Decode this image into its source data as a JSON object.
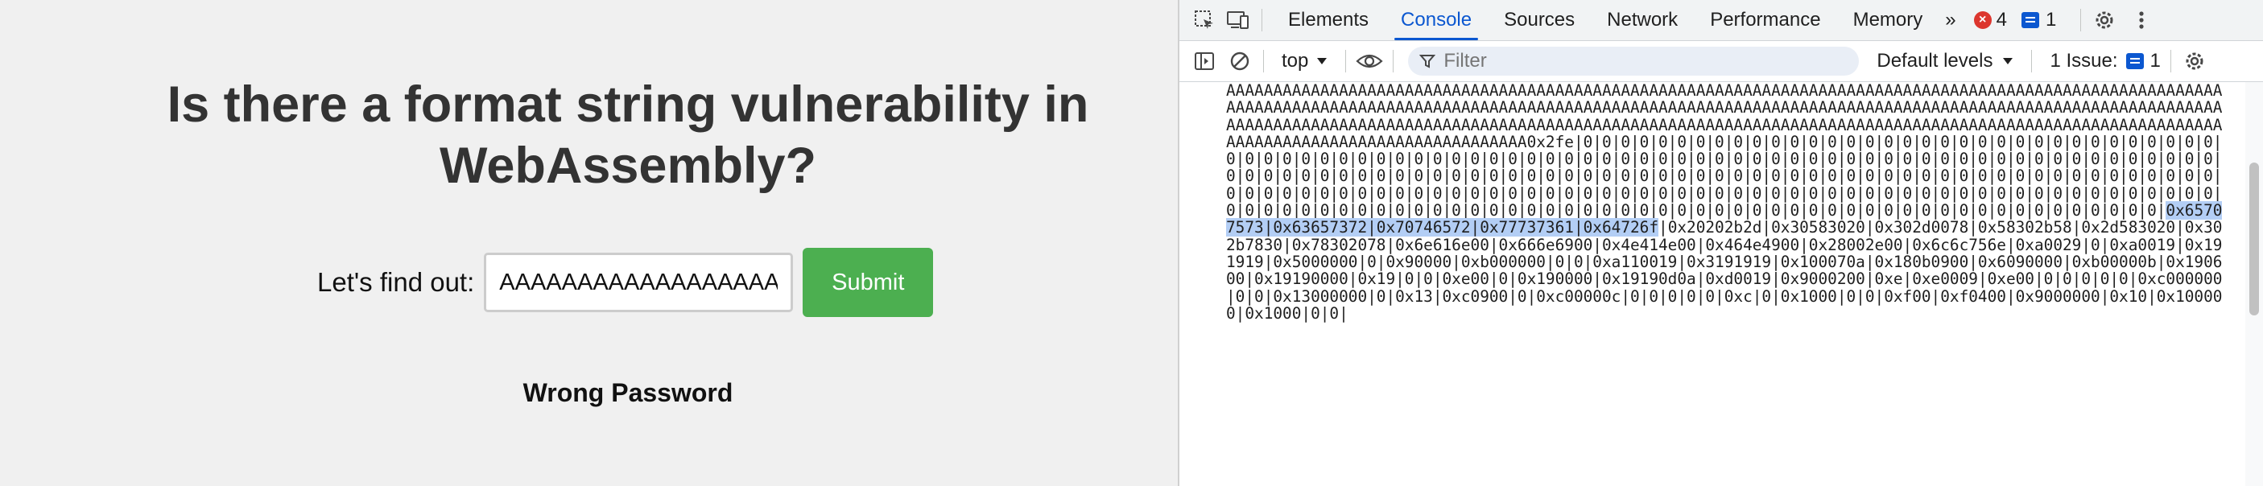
{
  "page": {
    "title": "Is there a format string vulnerability in WebAssembly?",
    "form_label": "Let's find out:",
    "input_value": "AAAAAAAAAAAAAAAAAAAAAAAAAAAAAAAAAAAA",
    "submit_label": "Submit",
    "result": "Wrong Password"
  },
  "devtools": {
    "tabs": [
      "Elements",
      "Console",
      "Sources",
      "Network",
      "Performance",
      "Memory"
    ],
    "active_tab": "Console",
    "more_tabs_glyph": "»",
    "error_count": "4",
    "message_count": "1",
    "context": "top",
    "filter_placeholder": "Filter",
    "levels": "Default levels",
    "issues_label": "1 Issue:",
    "issues_count": "1",
    "console": {
      "before_highlight": "AAAAAAAAAAAAAAAAAAAAAAAAAAAAAAAAAAAAAAAAAAAAAAAAAAAAAAAAAAAAAAAAAAAAAAAAAAAAAAAAAAAAAAAAAAAAAAAAAAAAAAAAAAAAAAAAAAAAAAAAAAAAAAAAAAAAAAAAAAAAAAAAAAAAAAAAAAAAAAAAAAAAAAAAAAAAAAAAAAAAAAAAAAAAAAAAAAAAAAAAAAAAAAAAAAAAAAAAAAAAAAAAAAAAAAAAAAAAAAAAAAAAAAAAAAAAAAAAAAAAAAAAAAAAAAAAAAAAAAAAAAAAAAAAAAAAAAAAAAAAAAAAAAAAAAAAAAAAAAAAAAAAAAAAAAAAAAAAAAAAAAAAAAAAAA0x2fe|0|0|0|0|0|0|0|0|0|0|0|0|0|0|0|0|0|0|0|0|0|0|0|0|0|0|0|0|0|0|0|0|0|0|0|0|0|0|0|0|0|0|0|0|0|0|0|0|0|0|0|0|0|0|0|0|0|0|0|0|0|0|0|0|0|0|0|0|0|0|0|0|0|0|0|0|0|0|0|0|0|0|0|0|0|0|0|0|0|0|0|0|0|0|0|0|0|0|0|0|0|0|0|0|0|0|0|0|0|0|0|0|0|0|0|0|0|0|0|0|0|0|0|0|0|0|0|0|0|0|0|0|0|0|0|0|0|0|0|0|0|0|0|0|0|0|0|0|0|0|0|0|0|0|0|0|0|0|0|0|0|0|0|0|0|0|0|0|0|0|0|0|0|0|0|0|0|0|0|0|0|0|0|0|0|0|0|0|0|0|0|0|0|0|0|0|0|0|0|0|0|0|0|0|0|0|0|0|0|0|0|0|0|0|0|0|0|0|0|0|0|0|0|0|0|0|0|0|0|0|0|0|0|0|0|0|0|0|0|0|0|0|0|",
      "highlight": "0x65707573|0x63657372|0x70746572|0x77737361|0x64726f",
      "after_highlight": "|0x20202b2d|0x30583020|0x302d0078|0x58302b58|0x2d583020|0x302b7830|0x78302078|0x6e616e00|0x666e6900|0x4e414e00|0x464e4900|0x28002e00|0x6c6c756e|0xa0029|0|0xa0019|0x191919|0x5000000|0|0x90000|0xb000000|0|0|0xa110019|0x3191919|0x100070a|0x180b0900|0x6090000|0xb00000b|0x190600|0x19190000|0x19|0|0|0xe00|0|0x190000|0x19190d0a|0xd0019|0x9000200|0xe|0xe0009|0xe00|0|0|0|0|0|0xc000000|0|0|0x13000000|0|0x13|0xc0900|0|0xc00000c|0|0|0|0|0|0xc|0|0x1000|0|0|0xf00|0xf0400|0x9000000|0x10|0x100000|0x1000|0|0|"
    }
  }
}
